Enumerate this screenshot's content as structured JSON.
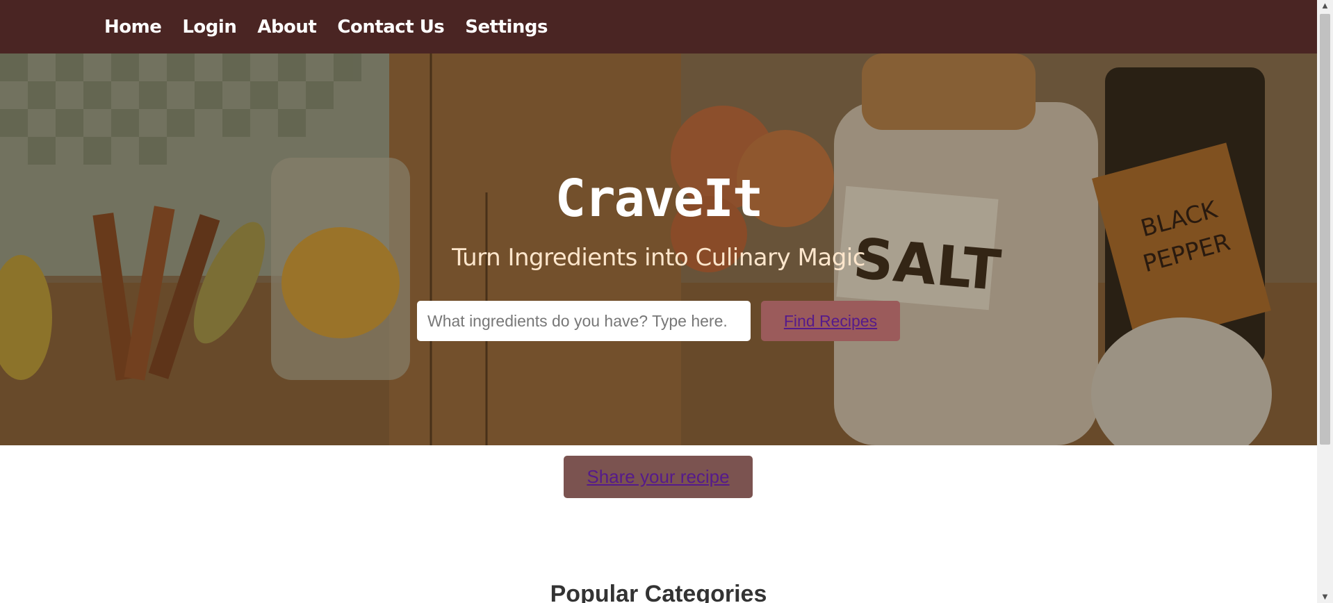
{
  "nav": {
    "items": [
      "Home",
      "Login",
      "About",
      "Contact Us",
      "Settings"
    ]
  },
  "hero": {
    "title": "CraveIt",
    "subtitle": "Turn Ingredients into Culinary Magic",
    "search_placeholder": "What ingredients do you have? Type here.",
    "search_value": "",
    "find_label": "Find Recipes",
    "background_image_labels": [
      "SALT",
      "BLACK PEPPER"
    ]
  },
  "share": {
    "label": "Share your recipe"
  },
  "sections": {
    "popular_heading": "Popular Categories"
  },
  "colors": {
    "navbar": "#4a2523",
    "find_button": "#9b5b5b",
    "share_button": "#7b5350",
    "link_text": "#551a8b"
  }
}
